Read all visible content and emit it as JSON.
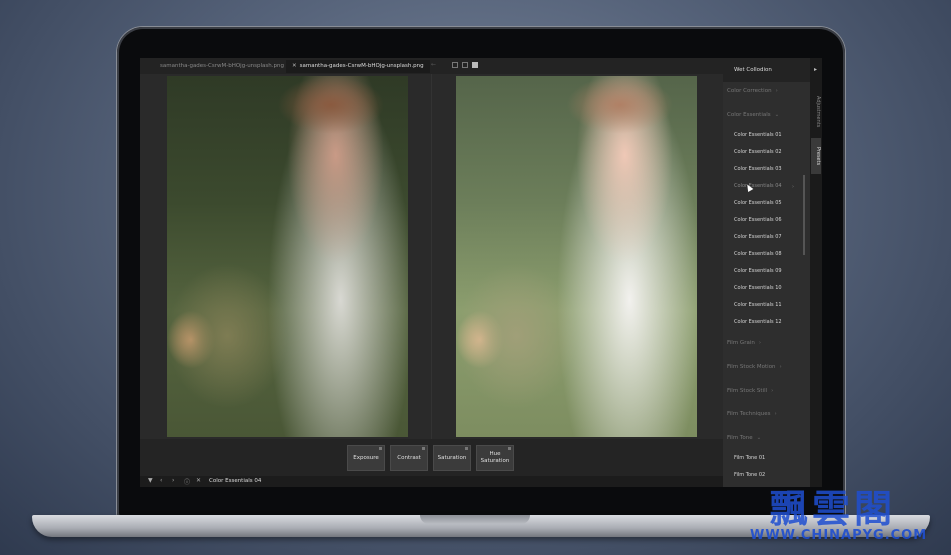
{
  "tabs": [
    {
      "label": "samantha-gades-CsrwM-bHOjg-unsplash.png",
      "active": false
    },
    {
      "label": "samantha-gades-CsrwM-bHOjg-unsplash.png",
      "active": true
    }
  ],
  "toolbar": {
    "buttons": [
      "Exposure",
      "Contrast",
      "Saturation",
      "Hue Saturation"
    ]
  },
  "status": {
    "current_preset": "Color Essentials 04"
  },
  "panel": {
    "top_item": "Wet Collodion",
    "categories": {
      "color_correction": "Color Correction",
      "color_essentials": "Color Essentials",
      "film_grain": "Film Grain",
      "film_stock_motion": "Film Stock Motion",
      "film_stock_still": "Film Stock Still",
      "film_techniques": "Film Techniques",
      "film_tone": "Film Tone"
    },
    "color_essentials_items": [
      "Color Essentials 01",
      "Color Essentials 02",
      "Color Essentials 03",
      "Color Essentials 04",
      "Color Essentials 05",
      "Color Essentials 06",
      "Color Essentials 07",
      "Color Essentials 08",
      "Color Essentials 09",
      "Color Essentials 10",
      "Color Essentials 11",
      "Color Essentials 12"
    ],
    "film_tone_items": [
      "Film Tone 01",
      "Film Tone 02"
    ],
    "hovered_item": "Color Essentials 04"
  },
  "side_tabs": {
    "adjustments": "Adjustments",
    "presets": "Presets",
    "active": "Presets"
  },
  "watermark": {
    "logo": "飄雲閣",
    "url": "WWW.CHINAPYG.COM"
  },
  "colors": {
    "accent": "#1f4fd1",
    "panel_bg": "#2e2e2e"
  }
}
